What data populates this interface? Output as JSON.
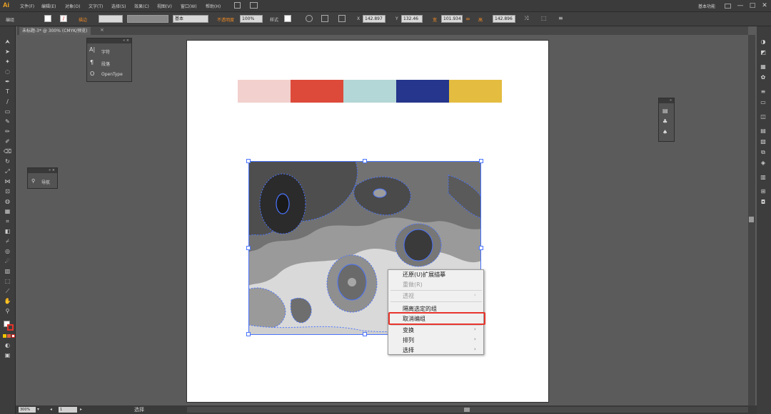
{
  "app": {
    "logo": "Ai"
  },
  "menubar": {
    "items": [
      "文件(F)",
      "编辑(E)",
      "对象(O)",
      "文字(T)",
      "选择(S)",
      "效果(C)",
      "视图(V)",
      "窗口(W)",
      "帮助(H)"
    ],
    "workspace": "基本功能",
    "win_min": "—",
    "win_max": "□",
    "win_close": "✕"
  },
  "controlbar": {
    "group_label": "编组",
    "stroke_label": "描边",
    "stroke_style": "基本",
    "opacity_label": "不透明度",
    "opacity_value": "100%",
    "style_label": "样式",
    "x_label": "X",
    "x_value": "142.897",
    "y_label": "Y",
    "y_value": "132.46",
    "w_label": "宽",
    "w_value": "101.934",
    "h_label": "高",
    "h_value": "142.896"
  },
  "document_tab": {
    "title": "未标题-3* @ 300% (CMYK/预览)",
    "close": "×"
  },
  "panels": {
    "character": {
      "rows": [
        "字符",
        "段落",
        "OpenType"
      ]
    },
    "navigator": {
      "rows": [
        "导航"
      ]
    }
  },
  "swatches": {
    "colors": [
      "#f2d0cd",
      "#dd4a3a",
      "#b3d6d6",
      "#25368c",
      "#e4bc40"
    ]
  },
  "context_menu": {
    "items": [
      {
        "label": "还原(U)扩展描摹",
        "disabled": false,
        "submenu": false
      },
      {
        "label": "重做(R)",
        "disabled": true,
        "submenu": false
      },
      {
        "label": "透视",
        "disabled": true,
        "submenu": true
      },
      {
        "label": "隔离选定的组",
        "disabled": false,
        "submenu": false
      },
      {
        "label": "取消编组",
        "disabled": false,
        "submenu": false
      },
      {
        "label": "变换",
        "disabled": false,
        "submenu": true
      },
      {
        "label": "排列",
        "disabled": false,
        "submenu": true
      },
      {
        "label": "选择",
        "disabled": false,
        "submenu": true
      }
    ],
    "highlighted": "取消编组"
  },
  "statusbar": {
    "zoom": "300%",
    "page": "1",
    "tool_text": "选择"
  },
  "colors": {
    "accent_orange": "#f08a24",
    "highlight_red": "#e8342a",
    "selection_blue": "#3d6cff"
  }
}
